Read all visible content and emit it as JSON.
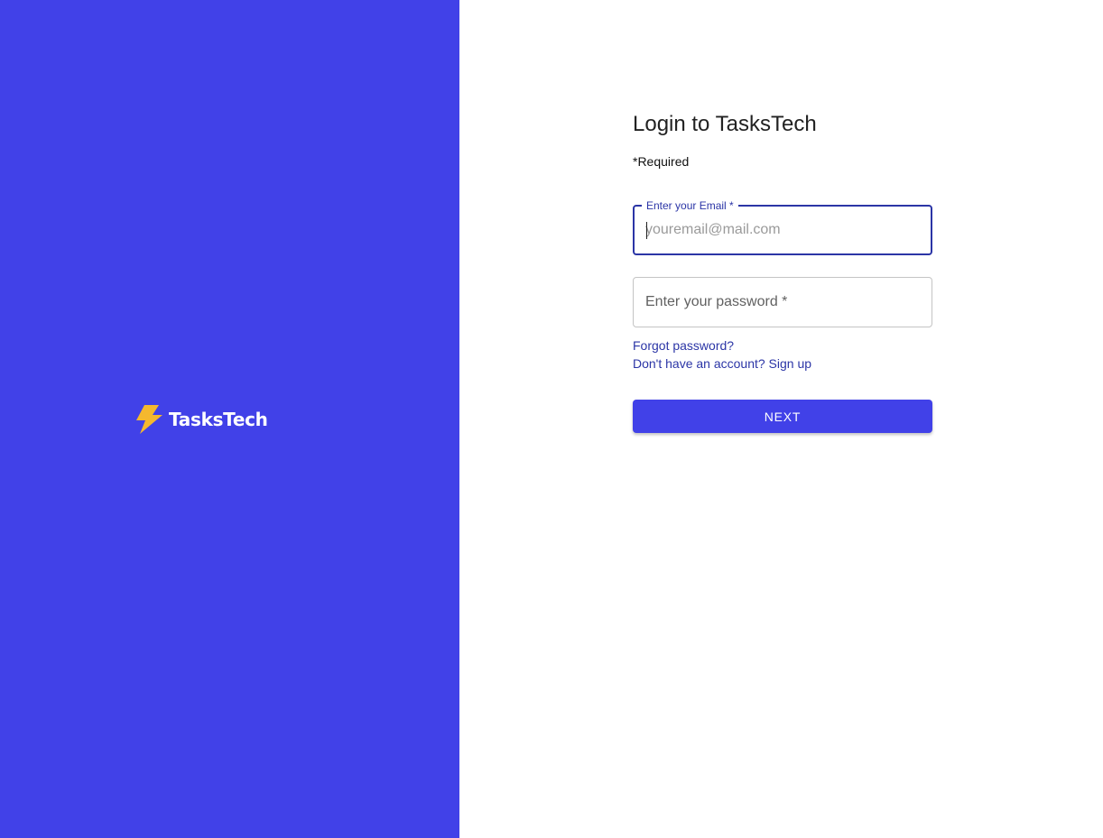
{
  "brand": {
    "name": "TasksTech",
    "icon": "lightning-bolt-icon",
    "panel_color": "#4141e8",
    "icon_color": "#f5b82e"
  },
  "form": {
    "title": "Login to TasksTech",
    "required_note": "*Required",
    "email": {
      "label": "Enter your Email *",
      "placeholder": "youremail@mail.com",
      "value": ""
    },
    "password": {
      "label": "Enter your password *",
      "value": ""
    },
    "forgot_password": "Forgot password?",
    "signup_prompt": "Don't have an account? Sign up",
    "submit_label": "NEXT",
    "accent_color": "#2b35a6"
  }
}
